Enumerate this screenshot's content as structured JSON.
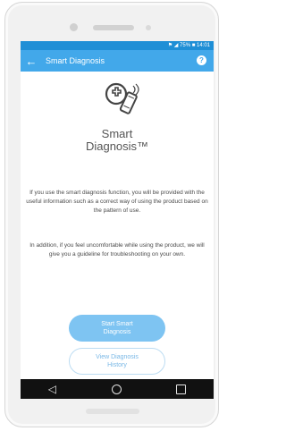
{
  "statusbar": {
    "text": "⚑ ◢ 75% ■ 14:01"
  },
  "appbar": {
    "title": "Smart Diagnosis"
  },
  "title": {
    "line1": "Smart",
    "line2": "Diagnosis™"
  },
  "description": [
    "If you use the smart diagnosis function, you will be provided with the useful information such as a correct way of using the product based on the pattern of use.",
    "In addition, if you feel uncomfortable while using the product, we will give you a guideline for troubleshooting on your own."
  ],
  "buttons": {
    "start": "Start Smart Diagnosis",
    "history": "View Diagnosis History"
  },
  "colors": {
    "statusbar": "#1f8fd6",
    "appbar": "#42a8ea",
    "primary_button": "#7ec4f2",
    "navbar": "#111111"
  }
}
